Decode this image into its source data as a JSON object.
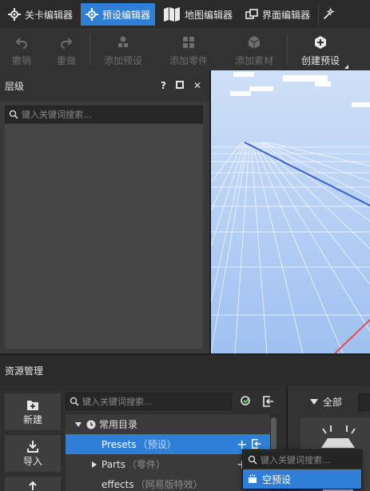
{
  "tabs": [
    {
      "label": "关卡编辑器",
      "icon": "crosshair-icon",
      "active": false
    },
    {
      "label": "预设编辑器",
      "icon": "crosshair-icon",
      "active": true
    },
    {
      "label": "地图编辑器",
      "icon": "map-icon",
      "active": false
    },
    {
      "label": "界面编辑器",
      "icon": "windows-icon",
      "active": false
    }
  ],
  "toolbar": {
    "undo": "撤销",
    "redo": "重做",
    "add_preset": "添加预设",
    "add_part": "添加零件",
    "add_asset": "添加素材",
    "create_preset": "创建预设"
  },
  "hierarchy": {
    "title": "层级",
    "help": "?",
    "close": "✕",
    "search_placeholder": "键入关键词搜索..."
  },
  "resources": {
    "title": "资源管理",
    "new_label": "新建",
    "import_label": "导入",
    "search_placeholder": "键入关键词搜索...",
    "filter_label": "全部",
    "tree": {
      "section": "常用目录",
      "items": [
        {
          "name": "Presets",
          "sub": "（预设）",
          "selected": true
        },
        {
          "name": "Parts",
          "sub": "（零件）",
          "selected": false
        },
        {
          "name": "effects",
          "sub": "（网易版特效）",
          "selected": false
        }
      ]
    }
  },
  "popup": {
    "search_placeholder": "键入关键词搜索...",
    "item": "空预设"
  },
  "colors": {
    "accent": "#2f7fd6",
    "sky": "#c5d9f5",
    "grid_line": "#ffffff",
    "axis_blue": "#3a5fd0",
    "axis_red": "#e05050"
  }
}
